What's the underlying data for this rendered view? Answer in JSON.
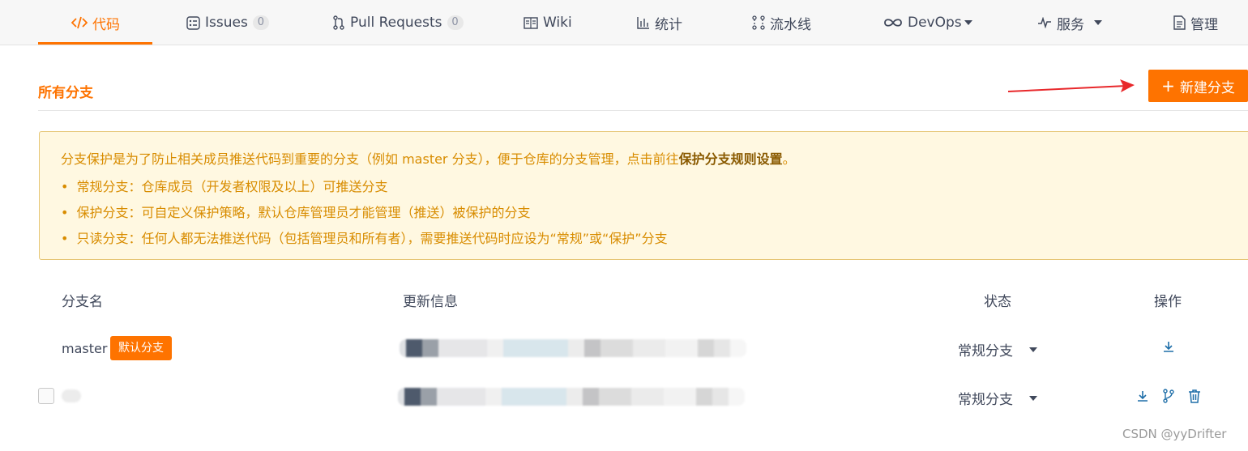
{
  "nav": {
    "items": [
      {
        "label": "代码",
        "icon": "code-icon",
        "active": true
      },
      {
        "label": "Issues",
        "icon": "issues-icon",
        "count": "0"
      },
      {
        "label": "Pull Requests",
        "icon": "pull-request-icon",
        "count": "0"
      },
      {
        "label": "Wiki",
        "icon": "wiki-book-icon"
      },
      {
        "label": "统计",
        "icon": "stats-chart-icon"
      },
      {
        "label": "流水线",
        "icon": "pipeline-icon"
      },
      {
        "label": "DevOps",
        "icon": "infinity-icon",
        "dropdown": true
      },
      {
        "label": "服务",
        "icon": "pulse-icon",
        "dropdown": true
      },
      {
        "label": "管理",
        "icon": "manage-document-icon"
      }
    ],
    "accent_color": "#fe7300"
  },
  "section": {
    "title": "所有分支",
    "new_branch_label": "新建分支"
  },
  "notice": {
    "lead": "分支保护是为了防止相关成员推送代码到重要的分支（例如 master 分支），便于仓库的分支管理，点击前往",
    "lead_link": "保护分支规则设置",
    "lead_end": "。",
    "items": [
      "常规分支：仓库成员（开发者权限及以上）可推送分支",
      "保护分支：可自定义保护策略，默认仓库管理员才能管理（推送）被保护的分支",
      "只读分支：任何人都无法推送代码（包括管理员和所有者），需要推送代码时应设为“常规”或“保护”分支"
    ]
  },
  "table": {
    "headers": {
      "name": "分支名",
      "update": "更新信息",
      "status": "状态",
      "ops": "操作"
    },
    "rows": [
      {
        "name": "master",
        "badge": "默认分支",
        "status": "常规分支"
      },
      {
        "name": "",
        "status": "常规分支"
      }
    ]
  },
  "watermark": "CSDN @yyDrifter"
}
